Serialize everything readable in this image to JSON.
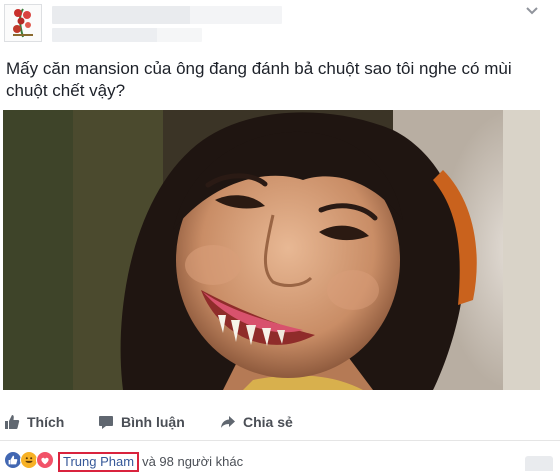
{
  "post": {
    "text": "Mấy căn mansion của ông đang đánh bả chuột sao tôi nghe có mùi chuột chết vậy?"
  },
  "actions": {
    "like_label": "Thích",
    "comment_label": "Bình luận",
    "share_label": "Chia sẻ"
  },
  "reactions": {
    "icons": [
      "like-icon",
      "haha-icon",
      "love-icon"
    ],
    "name": "Trung Pham",
    "others": "và 98 người khác"
  },
  "colors": {
    "link": "#365899",
    "highlight_box": "#d9233d",
    "action_text": "#4b4f56"
  }
}
